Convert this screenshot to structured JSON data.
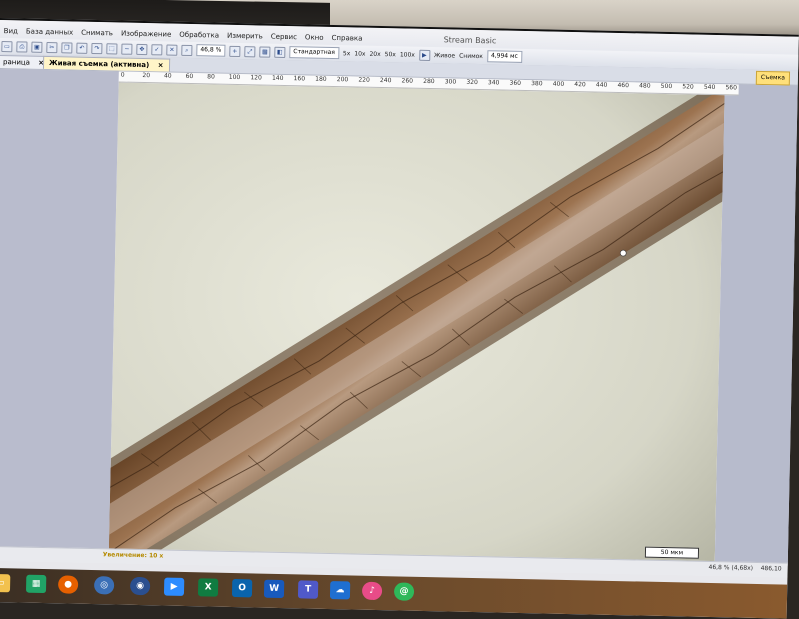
{
  "window": {
    "title": "Stream Basic"
  },
  "menu": [
    "Вид",
    "База данных",
    "Снимать",
    "Изображение",
    "Обработка",
    "Измерить",
    "Сервис",
    "Окно",
    "Справка"
  ],
  "toolbar": {
    "zoom_value": "46,8 %",
    "mode_select": "Стандартная",
    "objectives": [
      "5x",
      "10x",
      "20x",
      "50x",
      "100x"
    ],
    "live_label": "Живое",
    "snapshot_label": "Снимок",
    "exposure_value": "4,994 мс"
  },
  "tabs": [
    {
      "label": "раница",
      "active": false
    },
    {
      "label": "Живая съемка (активна)",
      "active": true
    }
  ],
  "capture_button": "Съемка",
  "ruler_ticks": [
    "0",
    "20",
    "40",
    "60",
    "80",
    "100",
    "120",
    "140",
    "160",
    "180",
    "200",
    "220",
    "240",
    "260",
    "280",
    "300",
    "320",
    "340",
    "360",
    "380",
    "400",
    "420",
    "440",
    "460",
    "480",
    "500",
    "520",
    "540",
    "560"
  ],
  "bottom": {
    "zoom_caption": "Увеличение:",
    "zoom_value": "10 x",
    "scale_bar": "50 мкм",
    "status_zoom": "46,8 % (4,68x)",
    "status_coord": "486,10"
  },
  "taskbar_icons": [
    "file-explorer-icon",
    "excel-like-icon",
    "firefox-icon",
    "app-icon-1",
    "app-icon-2",
    "zoom-icon",
    "excel-icon",
    "outlook-icon",
    "word-icon",
    "teams-icon",
    "cloud-icon",
    "music-icon",
    "mail-icon"
  ],
  "colors": {
    "accent": "#ffe07a",
    "tab_active": "#fff5c8",
    "sidebar": "#b9bccd"
  }
}
